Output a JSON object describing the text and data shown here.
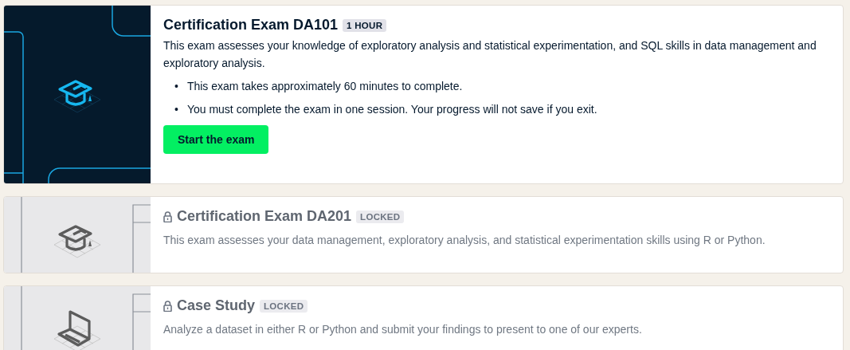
{
  "cards": [
    {
      "kind": "exam",
      "locked": false,
      "title": "Certification Exam DA101",
      "badge": "1 HOUR",
      "description": "This exam assesses your knowledge of exploratory analysis and statistical experimentation, and SQL skills in data management and exploratory analysis.",
      "bullets": [
        {
          "marker": "•",
          "text": "This exam takes approximately 60 minutes to complete."
        },
        {
          "marker": "•",
          "text": "You must complete the exam in one session. Your progress will not save if you exit."
        }
      ],
      "button": "Start the exam"
    },
    {
      "kind": "exam",
      "locked": true,
      "title": "Certification Exam DA201",
      "badge": "LOCKED",
      "description": "This exam assesses your data management, exploratory analysis, and statistical experimentation skills using R or Python."
    },
    {
      "kind": "case-study",
      "locked": true,
      "title": "Case Study",
      "badge": "LOCKED",
      "description": "Analyze a dataset in either R or Python and submit your findings to present to one of our experts."
    }
  ]
}
